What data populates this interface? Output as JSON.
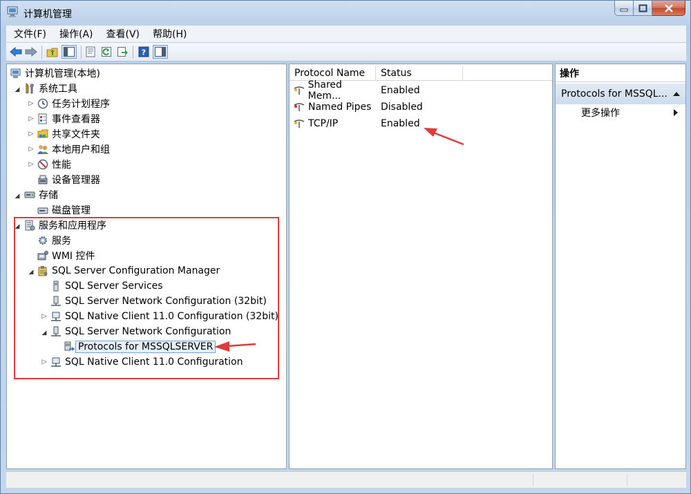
{
  "window": {
    "title": "计算机管理",
    "icon": "computer-management-icon"
  },
  "menu": [
    "文件(F)",
    "操作(A)",
    "查看(V)",
    "帮助(H)"
  ],
  "toolbar": {
    "icons": [
      "back-arrow-icon",
      "forward-arrow-icon",
      "up-folder-icon",
      "show-hide-tree-icon",
      "properties-icon",
      "refresh-icon",
      "export-list-icon",
      "help-icon",
      "show-hide-action-pane-icon"
    ]
  },
  "tree": {
    "root": "计算机管理(本地)",
    "system_tools": "系统工具",
    "task_scheduler": "任务计划程序",
    "event_viewer": "事件查看器",
    "shared_folders": "共享文件夹",
    "local_users": "本地用户和组",
    "performance": "性能",
    "device_manager": "设备管理器",
    "storage": "存储",
    "disk_management": "磁盘管理",
    "services_apps": "服务和应用程序",
    "services": "服务",
    "wmi": "WMI 控件",
    "sql_config_manager": "SQL Server Configuration Manager",
    "sql_services": "SQL Server Services",
    "sql_net_config_32": "SQL Server Network Configuration (32bit)",
    "sql_native_client_32": "SQL Native Client 11.0 Configuration (32bit)",
    "sql_net_config": "SQL Server Network Configuration",
    "protocols_mssqlserver": "Protocols for MSSQLSERVER",
    "sql_native_client": "SQL Native Client 11.0 Configuration"
  },
  "list": {
    "columns": [
      "Protocol Name",
      "Status"
    ],
    "rows": [
      {
        "name": "Shared Mem...",
        "status": "Enabled"
      },
      {
        "name": "Named Pipes",
        "status": "Disabled"
      },
      {
        "name": "TCP/IP",
        "status": "Enabled"
      }
    ]
  },
  "actions": {
    "title": "操作",
    "section": "Protocols for MSSQL...",
    "more": "更多操作"
  },
  "colors": {
    "annotation_red": "#e03a3a",
    "selection_bg": "#e6f0fb",
    "title_gradient": "#cfdff1"
  }
}
